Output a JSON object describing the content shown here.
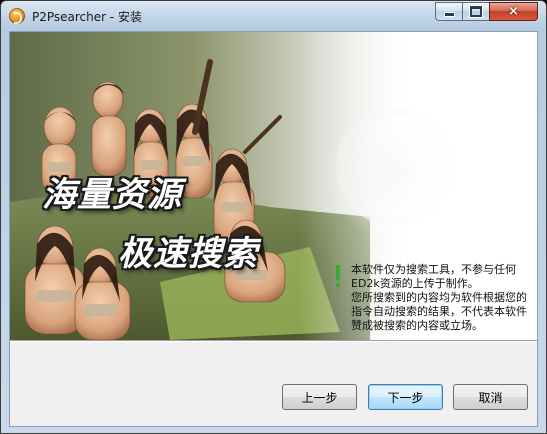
{
  "window": {
    "title": "P2Psearcher - 安装",
    "icon": "p2psearcher-app-icon",
    "controls": {
      "minimize": "minimize-icon",
      "maximize": "maximize-icon",
      "close": "×"
    }
  },
  "banner": {
    "slogan_line1": "海量资源",
    "slogan_line2": "极速搜索",
    "notice": "本软件仅为搜索工具，不参与任何ED2k资源的上传于制作。\n您所搜索到的内容均为软件根据您的指令自动搜索的结果，不代表本软件赞成被搜索的内容或立场。",
    "notice_accent_color": "#3aa832"
  },
  "buttons": {
    "back": "上一步",
    "next": "下一步",
    "cancel": "取消"
  }
}
